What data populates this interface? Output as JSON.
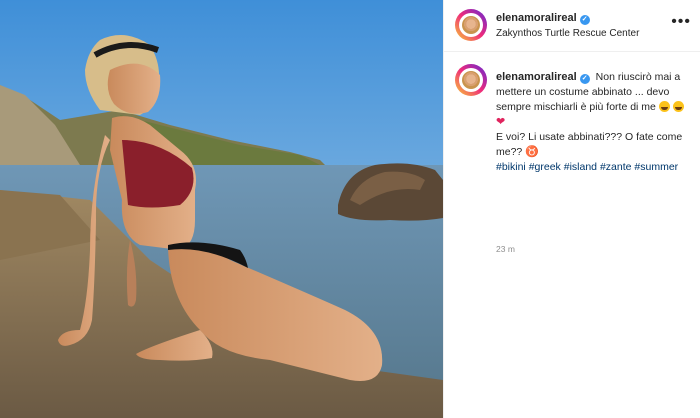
{
  "post": {
    "username": "elenamoralireal",
    "location": "Zakynthos Turtle Rescue Center",
    "more_icon": "more-horizontal-icon",
    "caption": {
      "line1": "Non riuscirò mai a mettere un costume abbinato ... devo sempre mischiarli è più forte di me",
      "line2": "E voi? Li usate abbinati??? O fate come me??",
      "hashtags": [
        "#bikini",
        "#greek",
        "#island",
        "#zante",
        "#summer"
      ]
    },
    "time_ago": "23 m"
  },
  "colors": {
    "verified_badge": "#3897f0",
    "hashtag": "#00376b",
    "text": "#262626",
    "muted": "#8e8e8e"
  }
}
